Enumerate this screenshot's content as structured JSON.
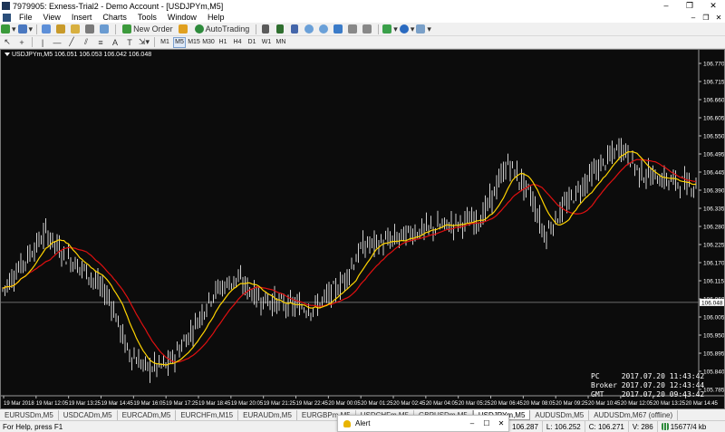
{
  "window": {
    "title": "7979905: Exness-Trial2 - Demo Account - [USDJPYm,M5]",
    "minimize": "–",
    "maximize": "❐",
    "close": "✕"
  },
  "menu": [
    "File",
    "View",
    "Insert",
    "Charts",
    "Tools",
    "Window",
    "Help"
  ],
  "toolbar": {
    "new_order": "New Order",
    "autotrading": "AutoTrading",
    "timeframes": [
      "M1",
      "M5",
      "M15",
      "M30",
      "H1",
      "H4",
      "D1",
      "W1",
      "MN"
    ],
    "active_timeframe": "M5"
  },
  "chart": {
    "caption": "USDJPYm,M5  106.051 106.053 106.042 106.048",
    "current_price": "106.048",
    "price_ticks": [
      "106.770",
      "106.715",
      "106.660",
      "106.605",
      "106.550",
      "106.495",
      "106.445",
      "106.390",
      "106.335",
      "106.280",
      "106.225",
      "106.170",
      "106.115",
      "106.060",
      "106.005",
      "105.950",
      "105.895",
      "105.840",
      "105.785"
    ],
    "time_ticks": [
      "19 Mar 2018",
      "19 Mar 12:05",
      "19 Mar 13:25",
      "19 Mar 14:45",
      "19 Mar 16:05",
      "19 Mar 17:25",
      "19 Mar 18:45",
      "19 Mar 20:05",
      "19 Mar 21:25",
      "19 Mar 22:45",
      "20 Mar 00:05",
      "20 Mar 01:25",
      "20 Mar 02:45",
      "20 Mar 04:05",
      "20 Mar 05:25",
      "20 Mar 06:45",
      "20 Mar 08:05",
      "20 Mar 09:25",
      "20 Mar 10:45",
      "20 Mar 12:05",
      "20 Mar 13:25",
      "20 Mar 14:45"
    ],
    "colors": {
      "background": "#0c0c0c",
      "candles": "#ffffff",
      "ma_fast": "#ffd400",
      "ma_slow": "#e01010",
      "grid_text": "#ffffff"
    }
  },
  "clock": {
    "pc_label": "PC",
    "pc_time": "2017.07.20 11:43:42",
    "broker_label": "Broker",
    "broker_time": "2017.07.20 12:43:44",
    "gmt_label": "GMT",
    "gmt_time": "2017.07.20 09:43:42"
  },
  "tabs": [
    "EURUSDm,M5",
    "USDCADm,M5",
    "EURCADm,M5",
    "EURCHFm,M15",
    "EURAUDm,M5",
    "EURGBPm,M5",
    "USDCHFm,M5",
    "GBPUSDm,M5",
    "USDJPYm,M5",
    "AUDUSDm,M5",
    "AUDUSDm,M67 (offline)"
  ],
  "active_tab": "USDJPYm,M5",
  "statusbar": {
    "help": "For Help, press F1",
    "high": "106.287",
    "low": "L: 106.252",
    "close": "C: 106.271",
    "volume": "V: 286",
    "traffic": "15677/4 kb"
  },
  "alert": {
    "title": "Alert",
    "minimize": "–",
    "maximize": "☐",
    "close": "✕"
  }
}
